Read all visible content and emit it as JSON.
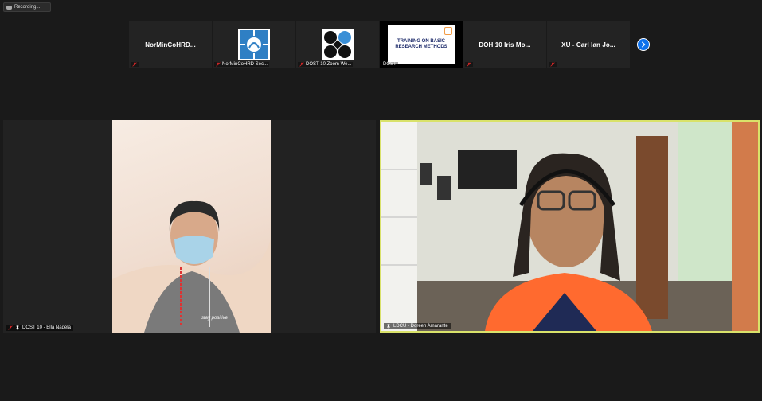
{
  "recording": {
    "label": "Recording..."
  },
  "participants_strip": [
    {
      "name": "NorMinCoHRD...",
      "label": "",
      "type": "name"
    },
    {
      "name": "",
      "label": "NorMinCoHRD Sec...",
      "type": "logo-blue"
    },
    {
      "name": "",
      "label": "DOST 10 Zoom We...",
      "type": "logo-dost"
    },
    {
      "name": "",
      "label": "DOST",
      "type": "slide",
      "slide_title": "TRAINING ON BASIC RESEARCH METHODS"
    },
    {
      "name": "DOH 10  Iris Mo...",
      "label": "",
      "type": "name"
    },
    {
      "name": "XU - Carl Ian Jo...",
      "label": "",
      "type": "name"
    }
  ],
  "videos": {
    "left": {
      "label": "DOST 10 - Ella Nadela",
      "shirt_text": "stay positive"
    },
    "right": {
      "label": "LDCU - Doreen Amarante"
    }
  },
  "colors": {
    "active_speaker": "#d9e26a",
    "accent": "#0e71eb",
    "muted": "#e02828"
  }
}
